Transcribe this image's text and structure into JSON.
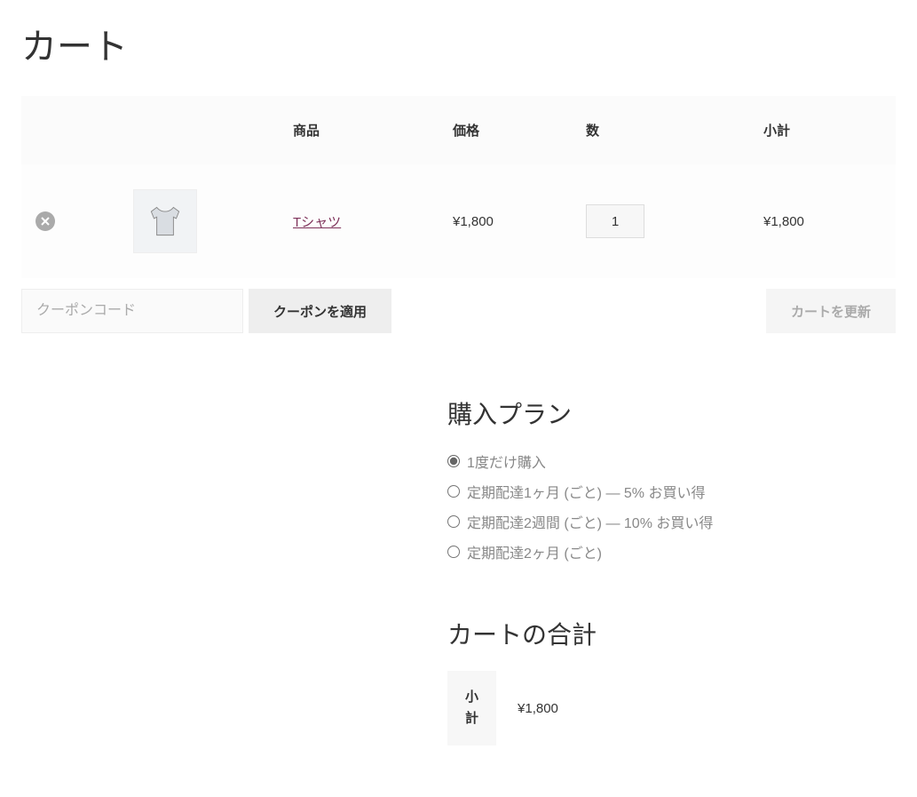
{
  "page_title": "カート",
  "cart": {
    "headers": {
      "product": "商品",
      "price": "価格",
      "quantity": "数",
      "subtotal": "小計"
    },
    "items": [
      {
        "name": "Tシャツ",
        "price": "¥1,800",
        "quantity": "1",
        "subtotal": "¥1,800"
      }
    ],
    "coupon_placeholder": "クーポンコード",
    "apply_coupon_label": "クーポンを適用",
    "update_cart_label": "カートを更新"
  },
  "purchase_plan": {
    "title": "購入プラン",
    "options": [
      {
        "label": "1度だけ購入",
        "checked": true
      },
      {
        "label": "定期配達1ヶ月 (ごと) — 5% お買い得",
        "checked": false
      },
      {
        "label": "定期配達2週間 (ごと) — 10% お買い得",
        "checked": false
      },
      {
        "label": "定期配達2ヶ月 (ごと)",
        "checked": false
      }
    ]
  },
  "cart_totals": {
    "title": "カートの合計",
    "rows": [
      {
        "label": "小計",
        "value": "¥1,800"
      }
    ]
  }
}
